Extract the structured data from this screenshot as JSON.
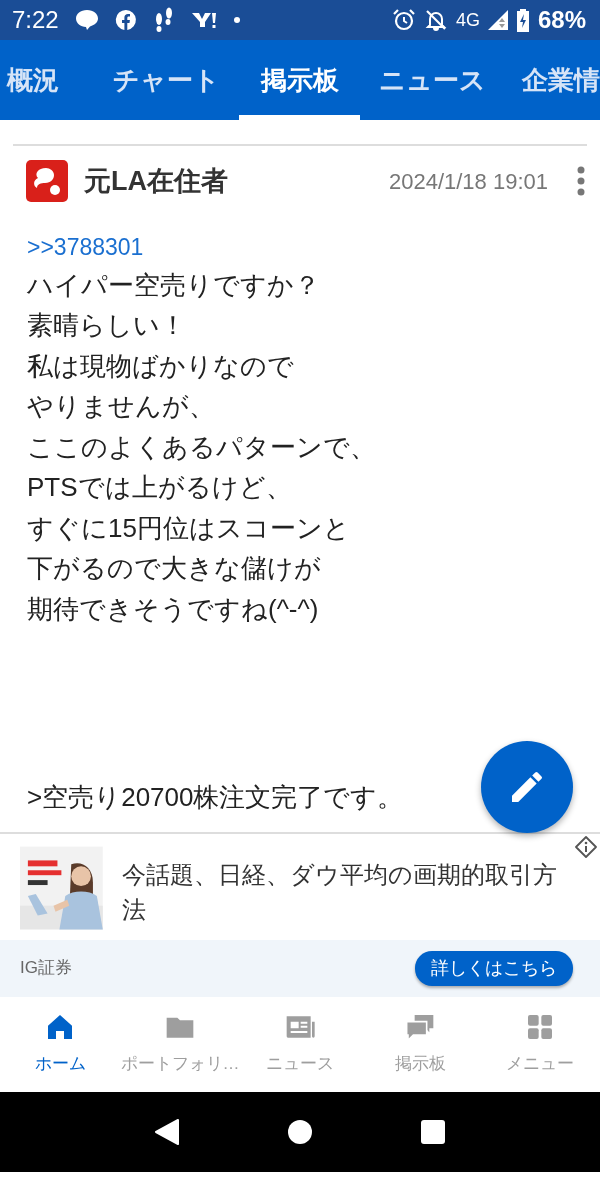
{
  "status_bar": {
    "time": "7:22",
    "network": "4G",
    "battery": "68%"
  },
  "tabs": [
    {
      "label": "概況",
      "selected": false
    },
    {
      "label": "チャート",
      "selected": false
    },
    {
      "label": "掲示板",
      "selected": true
    },
    {
      "label": "ニュース",
      "selected": false
    },
    {
      "label": "企業情",
      "selected": false
    }
  ],
  "post": {
    "author": "元LA在住者",
    "date": "2024/1/18 19:01",
    "reply_to": ">>3788301",
    "body": [
      "ハイパー空売りですか？",
      "素晴らしい！",
      "私は現物ばかりなので",
      "やりませんが、",
      "ここのよくあるパターンで、",
      "PTSでは上がるけど、",
      "すぐに15円位はスコーンと",
      "下がるので大きな儲けが",
      "期待できそうですね(^-^)"
    ],
    "quote": ">空売り20700株注文完了です。"
  },
  "ad": {
    "title": "今話題、日経、ダウ平均の画期的取引方法",
    "sponsor": "IG証券",
    "button": "詳しくはこちら"
  },
  "bottom_nav": [
    {
      "kind": "home",
      "label": "ホーム",
      "selected": true
    },
    {
      "kind": "folder",
      "label": "ポートフォリ…",
      "selected": false
    },
    {
      "kind": "news",
      "label": "ニュース",
      "selected": false
    },
    {
      "kind": "board",
      "label": "掲示板",
      "selected": false
    },
    {
      "kind": "menu",
      "label": "メニュー",
      "selected": false
    }
  ]
}
